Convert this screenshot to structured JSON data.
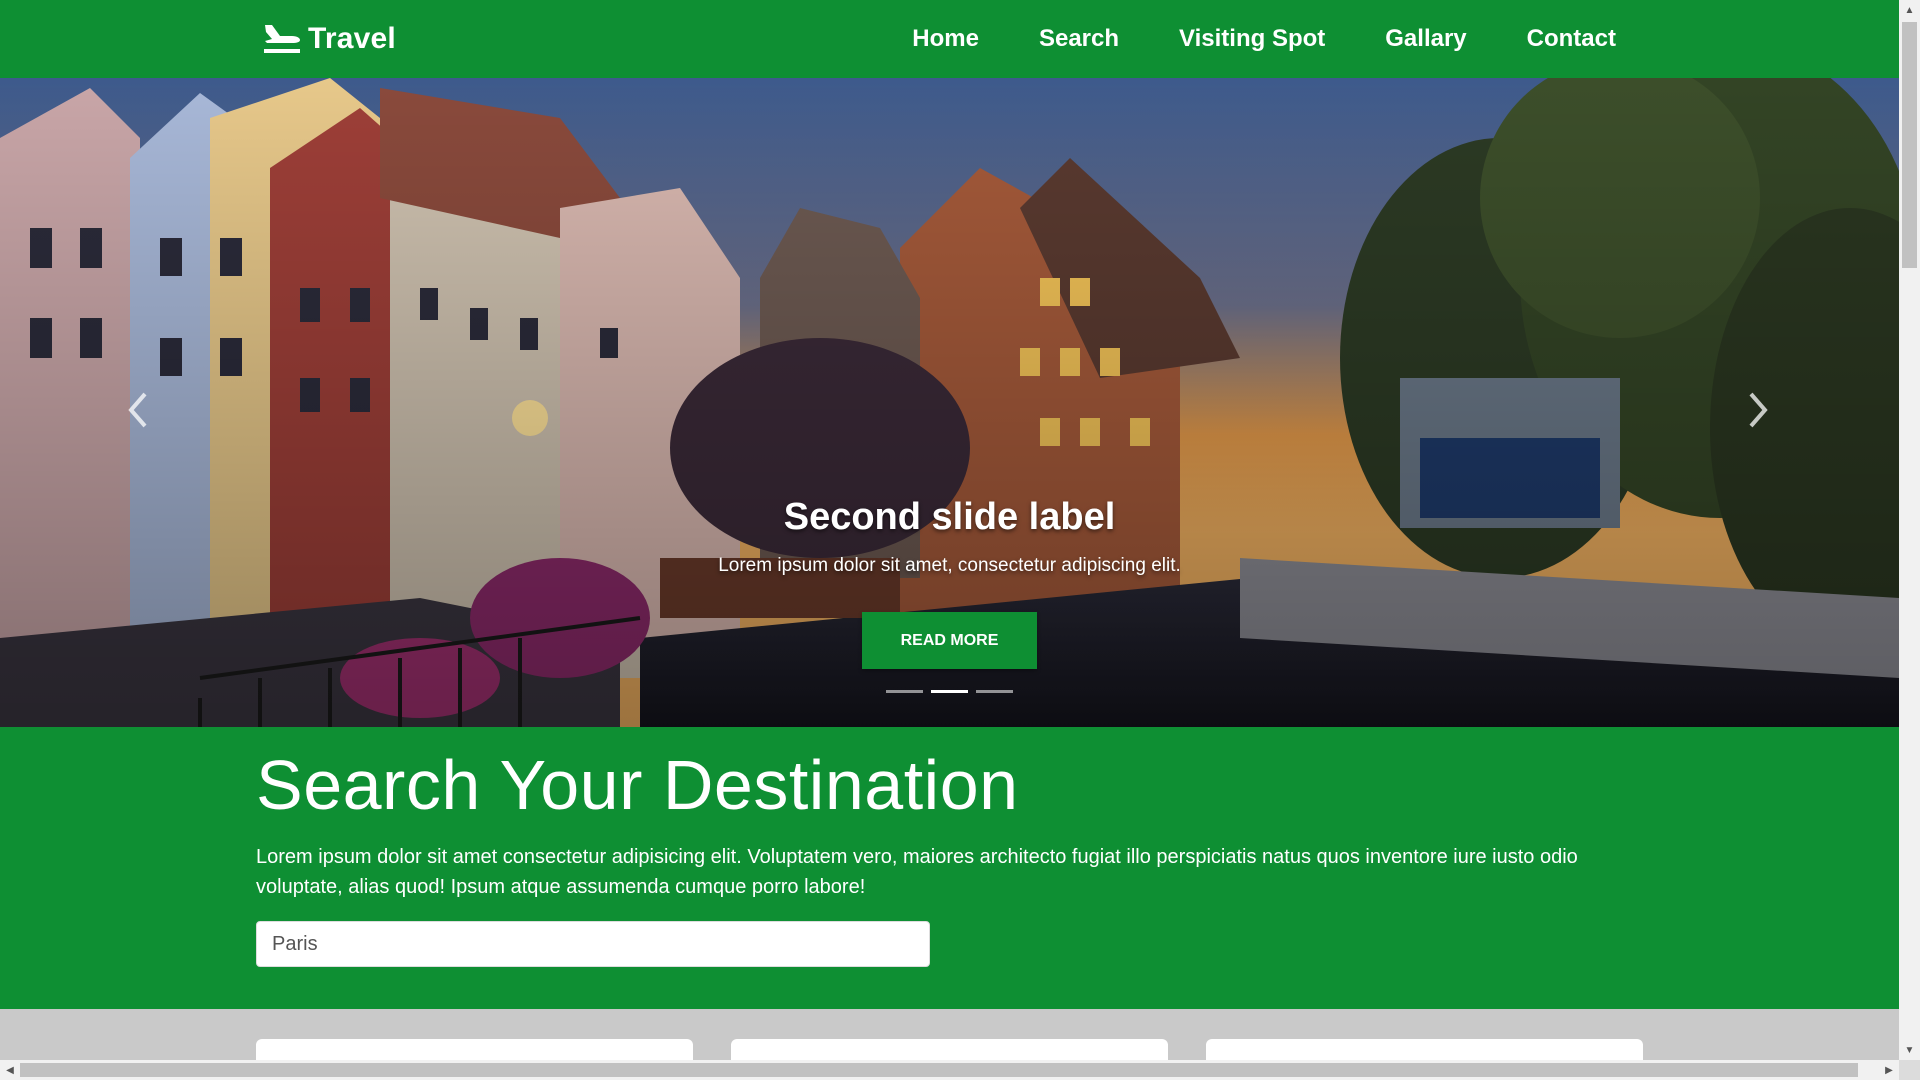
{
  "brand": {
    "name": "Travel",
    "icon": "plane-icon"
  },
  "nav": {
    "home": "Home",
    "search": "Search",
    "visiting_spot": "Visiting Spot",
    "gallery": "Gallary",
    "contact": "Contact"
  },
  "hero": {
    "caption_title": "Second slide label",
    "caption_text": "Lorem ipsum dolor sit amet, consectetur adipiscing elit.",
    "button_label": "READ MORE",
    "slide_count": 3,
    "active_slide": 2
  },
  "search": {
    "title": "Search Your Destination",
    "description": "Lorem ipsum dolor sit amet consectetur adipisicing elit. Voluptatem vero, maiores architecto fugiat illo perspiciatis natus quos inventore iure iusto odio voluptate, alias quod! Ipsum atque assumenda cumque porro labore!",
    "input_value": "Paris"
  },
  "colors": {
    "primary_green": "#0e8f33",
    "cards_background": "#c9c9c9"
  }
}
